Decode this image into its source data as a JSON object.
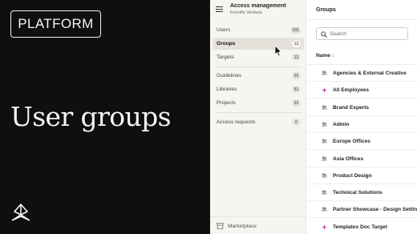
{
  "promo": {
    "badge": "PLATFORM",
    "headline": "User groups"
  },
  "sidebar": {
    "title": "Access management",
    "subtitle": "Frontify Ventura",
    "items": [
      {
        "label": "Users",
        "count": "291",
        "active": false
      },
      {
        "label": "Groups",
        "count": "12",
        "active": true
      },
      {
        "label": "Targets",
        "count": "12",
        "active": false
      },
      {
        "label": "Guidelines",
        "count": "25",
        "active": false
      },
      {
        "label": "Libraries",
        "count": "61",
        "active": false
      },
      {
        "label": "Projects",
        "count": "32",
        "active": false
      },
      {
        "label": "Access requests",
        "count": "0",
        "active": false
      }
    ],
    "footer_label": "Marketplace"
  },
  "main": {
    "title": "Groups",
    "search_placeholder": "Search",
    "column_header": "Name",
    "rows": [
      {
        "label": "Agencies & External Creative",
        "icon": "group-icon"
      },
      {
        "label": "All Employees",
        "icon": "sparkle-icon"
      },
      {
        "label": "Brand Experts",
        "icon": "group-icon"
      },
      {
        "label": "Admin",
        "icon": "group-icon"
      },
      {
        "label": "Europe Offices",
        "icon": "group-icon"
      },
      {
        "label": "Asia Offices",
        "icon": "group-icon"
      },
      {
        "label": "Product Design",
        "icon": "group-icon"
      },
      {
        "label": "Technical Solutions",
        "icon": "group-icon"
      },
      {
        "label": "Partner Showcase - Design Settings",
        "icon": "group-icon"
      },
      {
        "label": "Templates Doc Target",
        "icon": "sparkle-icon"
      }
    ]
  },
  "colors": {
    "promo_background": "#0f0f0f",
    "sidebar_background": "#f6f5f1",
    "active_item": "#e4e2da",
    "sparkle_icon": "#c030a8"
  }
}
